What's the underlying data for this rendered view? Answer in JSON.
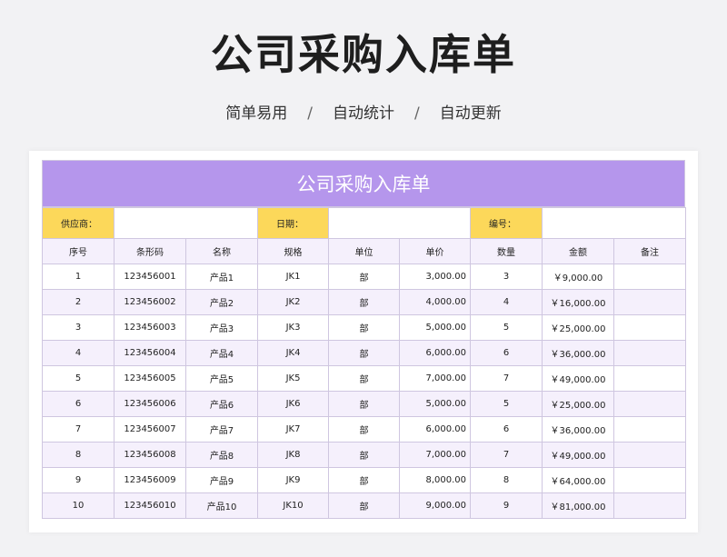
{
  "page": {
    "title": "公司采购入库单",
    "subtitle_parts": [
      "简单易用",
      "自动统计",
      "自动更新"
    ],
    "separator": "/"
  },
  "sheet": {
    "title": "公司采购入库单",
    "info": [
      {
        "label": "供应商：",
        "value": ""
      },
      {
        "label": "日期：",
        "value": ""
      },
      {
        "label": "编号：",
        "value": ""
      }
    ],
    "columns": [
      "序号",
      "条形码",
      "名称",
      "规格",
      "单位",
      "单价",
      "数量",
      "金额",
      "备注"
    ],
    "rows": [
      {
        "no": "1",
        "barcode": "123456001",
        "name": "产品1",
        "spec": "JK1",
        "unit": "部",
        "price": "3,000.00",
        "qty": "3",
        "amount": "￥9,000.00",
        "note": ""
      },
      {
        "no": "2",
        "barcode": "123456002",
        "name": "产品2",
        "spec": "JK2",
        "unit": "部",
        "price": "4,000.00",
        "qty": "4",
        "amount": "￥16,000.00",
        "note": ""
      },
      {
        "no": "3",
        "barcode": "123456003",
        "name": "产品3",
        "spec": "JK3",
        "unit": "部",
        "price": "5,000.00",
        "qty": "5",
        "amount": "￥25,000.00",
        "note": ""
      },
      {
        "no": "4",
        "barcode": "123456004",
        "name": "产品4",
        "spec": "JK4",
        "unit": "部",
        "price": "6,000.00",
        "qty": "6",
        "amount": "￥36,000.00",
        "note": ""
      },
      {
        "no": "5",
        "barcode": "123456005",
        "name": "产品5",
        "spec": "JK5",
        "unit": "部",
        "price": "7,000.00",
        "qty": "7",
        "amount": "￥49,000.00",
        "note": ""
      },
      {
        "no": "6",
        "barcode": "123456006",
        "name": "产品6",
        "spec": "JK6",
        "unit": "部",
        "price": "5,000.00",
        "qty": "5",
        "amount": "￥25,000.00",
        "note": ""
      },
      {
        "no": "7",
        "barcode": "123456007",
        "name": "产品7",
        "spec": "JK7",
        "unit": "部",
        "price": "6,000.00",
        "qty": "6",
        "amount": "￥36,000.00",
        "note": ""
      },
      {
        "no": "8",
        "barcode": "123456008",
        "name": "产品8",
        "spec": "JK8",
        "unit": "部",
        "price": "7,000.00",
        "qty": "7",
        "amount": "￥49,000.00",
        "note": ""
      },
      {
        "no": "9",
        "barcode": "123456009",
        "name": "产品9",
        "spec": "JK9",
        "unit": "部",
        "price": "8,000.00",
        "qty": "8",
        "amount": "￥64,000.00",
        "note": ""
      },
      {
        "no": "10",
        "barcode": "123456010",
        "name": "产品10",
        "spec": "JK10",
        "unit": "部",
        "price": "9,000.00",
        "qty": "9",
        "amount": "￥81,000.00",
        "note": ""
      }
    ]
  },
  "colors": {
    "header_bg": "#b596ec",
    "label_bg": "#fcd85a",
    "stripe_bg": "#f5f0fc",
    "border": "#cfc6e0"
  }
}
